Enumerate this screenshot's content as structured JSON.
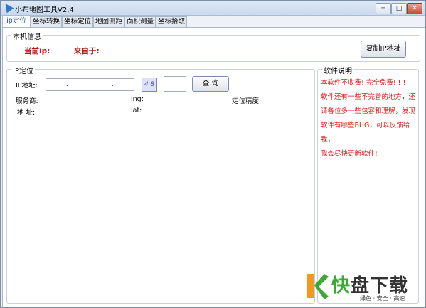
{
  "window": {
    "title": "小布地图工具V2.4",
    "controls": [
      "─",
      "□",
      "✕"
    ]
  },
  "tabs": [
    {
      "label": "ip定位"
    },
    {
      "label": "坐标转换"
    },
    {
      "label": "坐标定位"
    },
    {
      "label": "地图测距"
    },
    {
      "label": "面积测量"
    },
    {
      "label": "坐标拾取"
    }
  ],
  "local_info": {
    "group_label": "本机信息",
    "current_ip_label": "当前ip:",
    "from_label": "来自于:",
    "copy_button": "复制IP地址"
  },
  "ip_locate": {
    "group_label": "IP定位",
    "ip_label": "IP地址:",
    "ip_separators": [
      ".",
      ".",
      "."
    ],
    "captcha_text": "4 8",
    "query_button": "查 询",
    "isp_label": "服务商:",
    "lng_label": "lng:",
    "precision_label": "定位精度:",
    "address_label": "地 址:",
    "lat_label": "lat:"
  },
  "description": {
    "group_label": "软件说明",
    "lines": [
      "本软件不收费! 完全免费! ! !",
      "软件还有一些不完善的地方，还",
      "请各位多一些包容和理解，发现",
      "软件有哪些BUG，可以反馈给我，",
      "我会尽快更新软件!"
    ]
  },
  "watermark": {
    "main": "快盘下载",
    "sub": "绿色 · 安全 · 高速",
    "colors": {
      "orange": "#f39a1e",
      "green": "#3aa935",
      "dark": "#333333"
    }
  }
}
